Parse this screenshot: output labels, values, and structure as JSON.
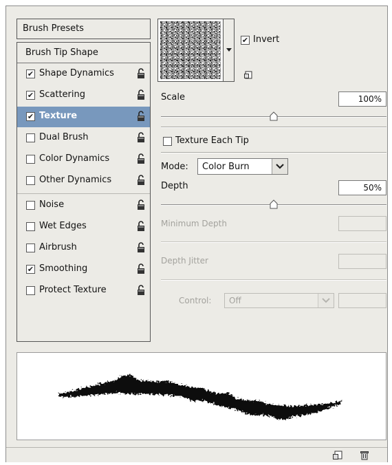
{
  "presets": {
    "label": "Brush Presets"
  },
  "tip_shape": {
    "label": "Brush Tip Shape"
  },
  "options": [
    {
      "label": "Shape Dynamics",
      "checked": true
    },
    {
      "label": "Scattering",
      "checked": true
    },
    {
      "label": "Texture",
      "checked": true,
      "selected": true
    },
    {
      "label": "Dual Brush",
      "checked": false
    },
    {
      "label": "Color Dynamics",
      "checked": false
    },
    {
      "label": "Other Dynamics",
      "checked": false
    },
    {
      "label": "Noise",
      "checked": false
    },
    {
      "label": "Wet Edges",
      "checked": false
    },
    {
      "label": "Airbrush",
      "checked": false
    },
    {
      "label": "Smoothing",
      "checked": true
    },
    {
      "label": "Protect Texture",
      "checked": false
    }
  ],
  "texture": {
    "invert_label": "Invert",
    "invert_checked": true,
    "scale_label": "Scale",
    "scale_value": "100%",
    "scale_fraction": 0.5,
    "each_tip_label": "Texture Each Tip",
    "each_tip_checked": false,
    "mode_label": "Mode:",
    "mode_value": "Color Burn",
    "depth_label": "Depth",
    "depth_value": "50%",
    "depth_fraction": 0.5,
    "min_depth_label": "Minimum Depth",
    "depth_jitter_label": "Depth Jitter",
    "control_label": "Control:",
    "control_value": "Off"
  },
  "colors": {
    "panel_bg": "#ecebe6",
    "selected_bg": "#7898bd"
  }
}
